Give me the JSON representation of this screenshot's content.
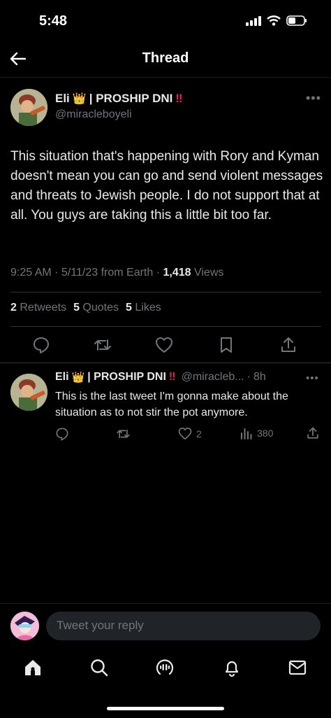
{
  "status_bar": {
    "time": "5:48"
  },
  "header": {
    "title": "Thread"
  },
  "tweet": {
    "display_name": "Eli",
    "name_suffix": "| PROSHIP DNI",
    "handle": "@miracleboyeli",
    "text": "This situation that's happening with Rory and Kyman doesn't mean you can go and send violent messages and threats to Jewish people. I do not support that at all. You guys are taking this a little bit too far.",
    "time": "9:25 AM",
    "date": "5/11/23",
    "source": "from Earth",
    "views_count": "1,418",
    "views_label": "Views",
    "retweets_count": "2",
    "retweets_label": "Retweets",
    "quotes_count": "5",
    "quotes_label": "Quotes",
    "likes_count": "5",
    "likes_label": "Likes"
  },
  "reply": {
    "display_name": "Eli",
    "name_suffix": "| PROSHIP DNI",
    "handle": "@miracleb...",
    "age": "8h",
    "text": "This is the last tweet I'm gonna make about the situation as to not stir the pot anymore.",
    "likes": "2",
    "views": "380"
  },
  "composer": {
    "placeholder": "Tweet your reply"
  },
  "colors": {
    "background": "#000000",
    "text": "#e7e9ea",
    "muted": "#71767b",
    "accent_red": "#e0245e"
  },
  "icons": [
    "back-arrow-icon",
    "crown-emoji-icon",
    "double-exclamation-icon",
    "more-icon",
    "reply-icon",
    "retweet-icon",
    "like-icon",
    "bookmark-icon",
    "share-icon",
    "views-icon",
    "home-icon",
    "search-icon",
    "spaces-icon",
    "notifications-icon",
    "messages-icon"
  ]
}
